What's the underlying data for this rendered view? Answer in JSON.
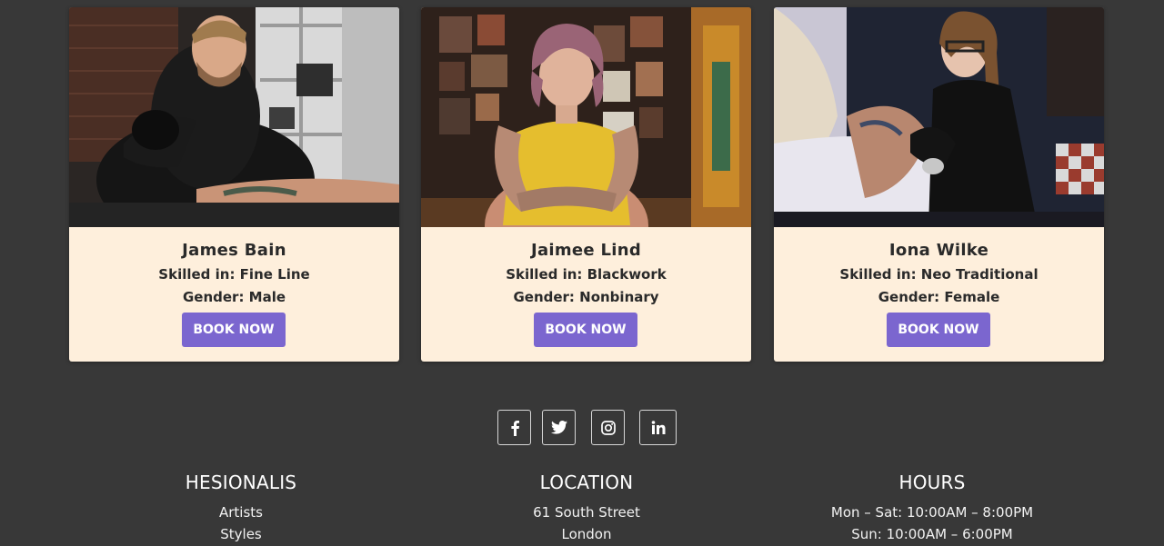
{
  "artists": [
    {
      "name": "James Bain",
      "skill": "Skilled in: Fine Line",
      "gender": "Gender: Male",
      "button_label": "BOOK NOW"
    },
    {
      "name": "Jaimee Lind",
      "skill": "Skilled in: Blackwork",
      "gender": "Gender: Nonbinary",
      "button_label": "BOOK NOW"
    },
    {
      "name": "Iona Wilke",
      "skill": "Skilled in: Neo Traditional",
      "gender": "Gender: Female",
      "button_label": "BOOK NOW"
    }
  ],
  "social": [
    {
      "icon": "facebook-icon"
    },
    {
      "icon": "twitter-icon"
    },
    {
      "icon": "instagram-icon"
    },
    {
      "icon": "linkedin-icon"
    }
  ],
  "footer": {
    "brand": {
      "heading": "HESIONALIS",
      "links": [
        "Artists",
        "Styles"
      ]
    },
    "location": {
      "heading": "LOCATION",
      "lines": [
        "61 South Street",
        "London"
      ]
    },
    "hours": {
      "heading": "HOURS",
      "lines": [
        "Mon – Sat: 10:00AM – 8:00PM",
        "Sun: 10:00AM – 6:00PM"
      ]
    }
  },
  "colors": {
    "background": "#383838",
    "card": "#feefdc",
    "accent_button": "#7b66cf",
    "text_dark": "#2a2a2a",
    "text_light": "#ffffff"
  }
}
